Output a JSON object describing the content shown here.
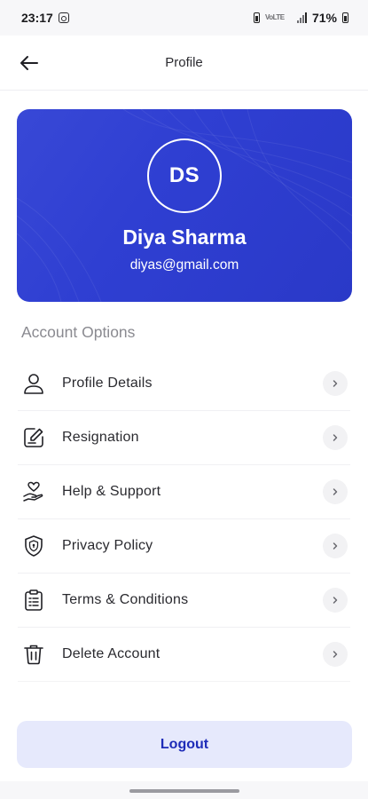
{
  "status_bar": {
    "time": "23:17",
    "network": "VoLTE",
    "battery": "71%"
  },
  "header": {
    "title": "Profile"
  },
  "profile": {
    "initials": "DS",
    "name": "Diya Sharma",
    "email": "diyas@gmail.com"
  },
  "section": {
    "title": "Account Options"
  },
  "options": [
    {
      "label": "Profile Details",
      "icon": "user-icon"
    },
    {
      "label": "Resignation",
      "icon": "edit-document-icon"
    },
    {
      "label": "Help & Support",
      "icon": "hand-heart-icon"
    },
    {
      "label": "Privacy Policy",
      "icon": "shield-icon"
    },
    {
      "label": "Terms & Conditions",
      "icon": "clipboard-icon"
    },
    {
      "label": "Delete Account",
      "icon": "trash-icon"
    }
  ],
  "logout": {
    "label": "Logout"
  },
  "colors": {
    "card_gradient_start": "#3848d6",
    "card_gradient_end": "#2a39c8",
    "logout_bg": "#e6e9fc",
    "logout_text": "#1e2cb8"
  }
}
